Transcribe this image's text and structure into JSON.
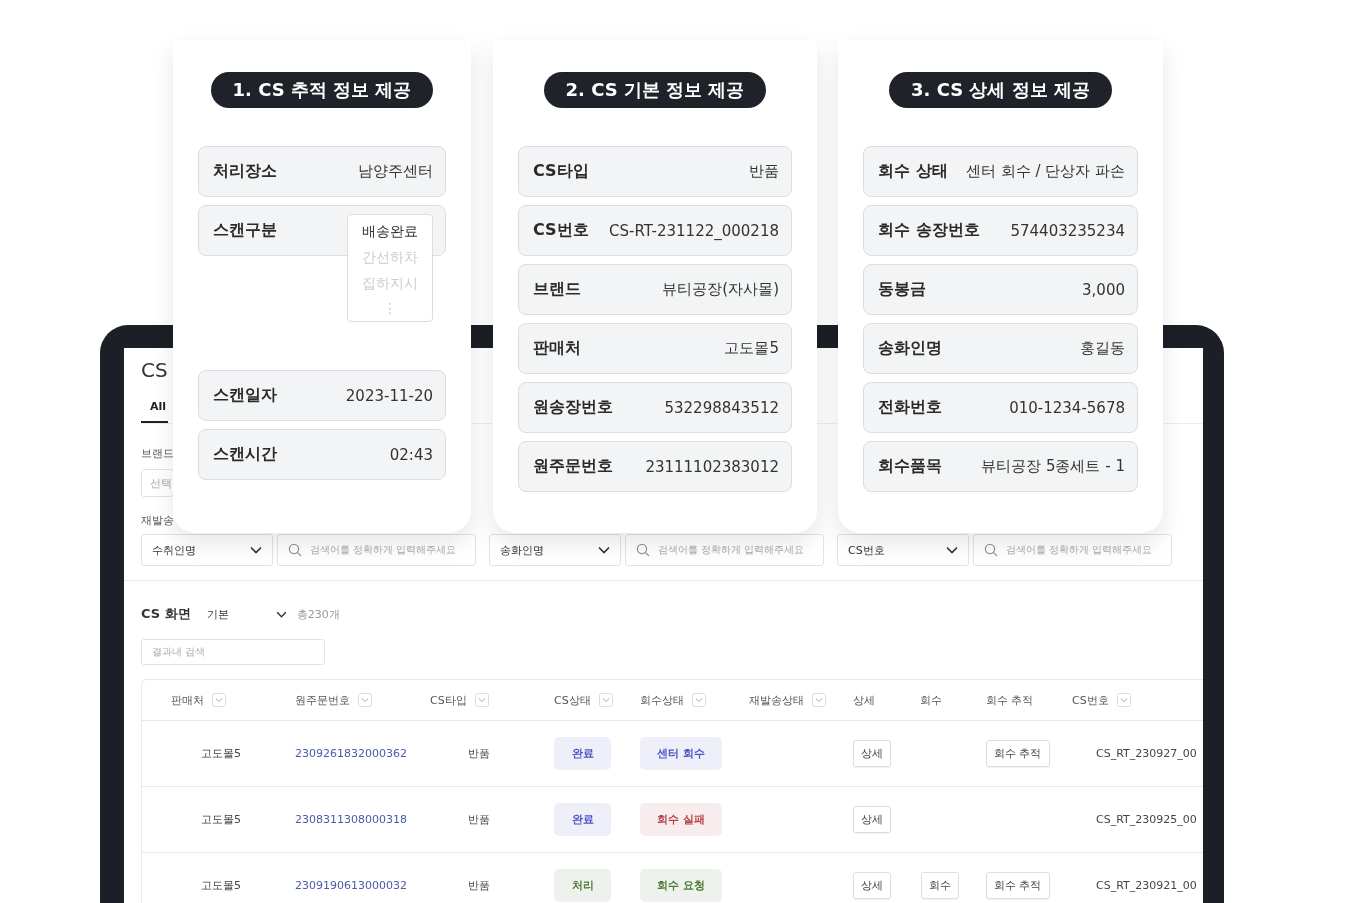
{
  "screen": {
    "title": "CS",
    "tabs": [
      {
        "label": "All",
        "selected": true
      }
    ],
    "filter_row_1": {
      "label": "브랜드",
      "placeholder": "선택"
    },
    "filter_row_2": {
      "label": "재발송",
      "groups": [
        {
          "select": "수취인명",
          "placeholder": "검색어를 정확하게 입력해주세요"
        },
        {
          "select": "송화인명",
          "placeholder": "검색어를 정확하게 입력해주세요"
        },
        {
          "select": "CS번호",
          "placeholder": "검색어를 정확하게 입력해주세요"
        }
      ]
    },
    "list": {
      "title": "CS 화면",
      "view": "기본",
      "count": "총230개",
      "search_placeholder": "결과내 검색"
    },
    "table": {
      "columns": [
        {
          "label": "판매처",
          "sortable": true
        },
        {
          "label": "원주문번호",
          "sortable": true
        },
        {
          "label": "CS타입",
          "sortable": true
        },
        {
          "label": "CS상태",
          "sortable": true
        },
        {
          "label": "회수상태",
          "sortable": true
        },
        {
          "label": "재발송상태",
          "sortable": true
        },
        {
          "label": "상세",
          "sortable": false
        },
        {
          "label": "회수",
          "sortable": false
        },
        {
          "label": "회수 추적",
          "sortable": false
        },
        {
          "label": "CS번호",
          "sortable": true
        }
      ],
      "rows": [
        {
          "seller": "고도몰5",
          "order_no": "2309261832000362",
          "cs_type": "반품",
          "cs_status": {
            "label": "완료",
            "color": "#4b55c4"
          },
          "return_status": {
            "label": "센터 회수",
            "color": "#4b55c4"
          },
          "detail": "상세",
          "collect": null,
          "track": "회수 추적",
          "cs_no": "CS_RT_230927_00"
        },
        {
          "seller": "고도몰5",
          "order_no": "2308311308000318",
          "cs_type": "반품",
          "cs_status": {
            "label": "완료",
            "color": "#4b55c4"
          },
          "return_status": {
            "label": "회수 실패",
            "color": "#b5444a"
          },
          "detail": "상세",
          "collect": null,
          "track": null,
          "cs_no": "CS_RT_230925_00"
        },
        {
          "seller": "고도몰5",
          "order_no": "2309190613000032",
          "cs_type": "반품",
          "cs_status": {
            "label": "처리",
            "color": "#4f7a3a"
          },
          "return_status": {
            "label": "회수 요청",
            "color": "#4f7a3a"
          },
          "detail": "상세",
          "collect": "회수",
          "track": "회수 추적",
          "cs_no": "CS_RT_230921_00"
        }
      ]
    }
  },
  "cards": [
    {
      "badge": "1. CS 추적 정보 제공",
      "rows": [
        {
          "kind": "value",
          "label": "처리장소",
          "value": "남양주센터"
        },
        {
          "kind": "dropdown",
          "label": "스캔구분",
          "options": [
            {
              "label": "배송완료",
              "selected": true
            },
            {
              "label": "간선하차",
              "selected": false
            },
            {
              "label": "집하지시",
              "selected": false
            }
          ],
          "more": "⋮"
        },
        {
          "kind": "value",
          "label": "스캔일자",
          "value": "2023-11-20"
        },
        {
          "kind": "value",
          "label": "스캔시간",
          "value": "02:43"
        }
      ]
    },
    {
      "badge": "2. CS 기본 정보 제공",
      "rows": [
        {
          "kind": "value",
          "label": "CS타입",
          "value": "반품"
        },
        {
          "kind": "value",
          "label": "CS번호",
          "value": "CS-RT-231122_000218"
        },
        {
          "kind": "value",
          "label": "브랜드",
          "value": "뷰티공장(자사몰)"
        },
        {
          "kind": "value",
          "label": "판매처",
          "value": "고도몰5"
        },
        {
          "kind": "value",
          "label": "원송장번호",
          "value": "532298843512"
        },
        {
          "kind": "value",
          "label": "원주문번호",
          "value": "23111102383012"
        }
      ]
    },
    {
      "badge": "3. CS 상세 정보 제공",
      "rows": [
        {
          "kind": "value",
          "label": "회수 상태",
          "value": "센터 회수 / 단상자 파손"
        },
        {
          "kind": "value",
          "label": "회수 송장번호",
          "value": "574403235234"
        },
        {
          "kind": "value",
          "label": "동봉금",
          "value": "3,000"
        },
        {
          "kind": "value",
          "label": "송화인명",
          "value": "홍길동"
        },
        {
          "kind": "value",
          "label": "전화번호",
          "value": "010-1234-5678"
        },
        {
          "kind": "value",
          "label": "회수품목",
          "value": "뷰티공장 5종세트 - 1"
        }
      ]
    }
  ]
}
